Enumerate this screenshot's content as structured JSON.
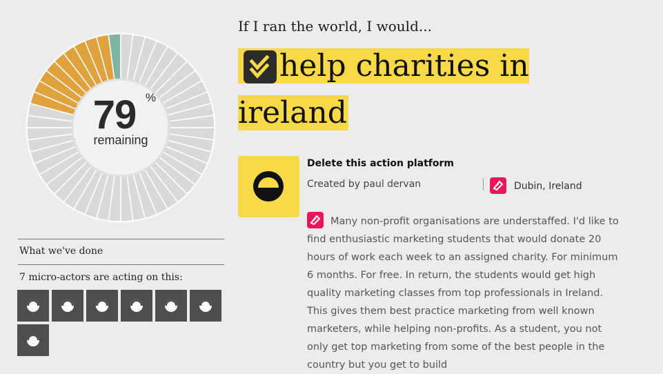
{
  "progress": {
    "percent_remaining": "79",
    "percent_sign": "%",
    "remaining_label": "remaining",
    "done_fraction": 0.21,
    "colors": {
      "orange": "#e0a23c",
      "teal": "#7fb3a3",
      "gray": "#d9d9d9"
    }
  },
  "sidebar": {
    "done_title": "What we've done",
    "actors_title": "7 micro-actors are acting on this:",
    "actors_count": 7
  },
  "main": {
    "kicker": "If I ran the world, I would...",
    "headline": "help charities in ireland",
    "headline_icon": "checkmark-icon",
    "platform_title": "Delete this action platform",
    "creator": "Created by paul dervan",
    "location": "Dubin, Ireland",
    "description": "Many non-profit organisations are understaffed. I'd like to find enthusiastic marketing students that would donate 20 hours of work each week to an assigned charity. For minimum 6 months. For free. In return, the students would get high quality marketing classes from top professionals in Ireland. This gives them best practice marketing from well known marketers, while helping non-profits. As a student, you not only get top marketing from some of the best people in the country but you get to build",
    "accent_color": "#f7d94a",
    "pin_color": "#e8175d"
  }
}
